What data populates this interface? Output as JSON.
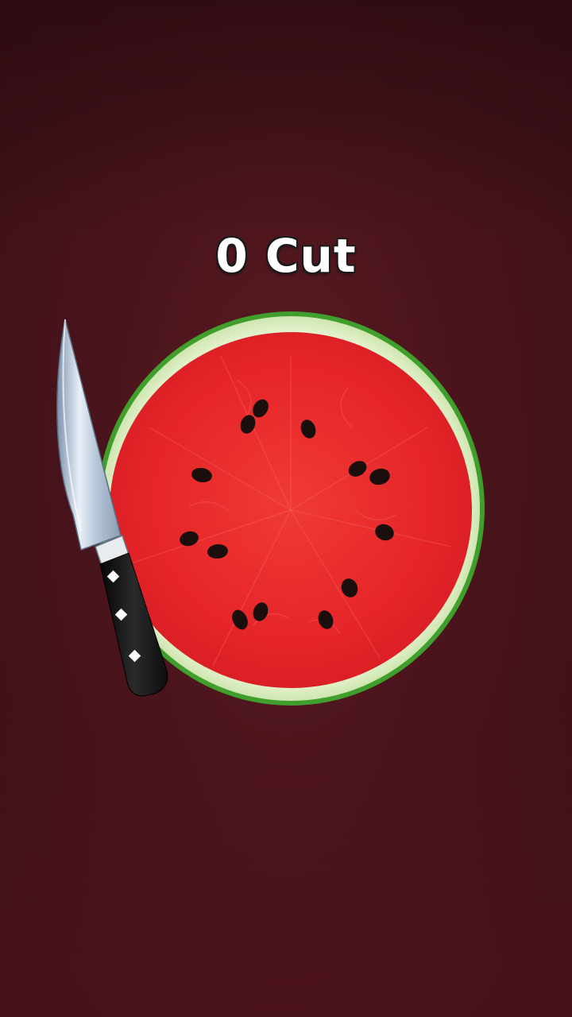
{
  "hud": {
    "cut_count": "0 Cut"
  },
  "game": {
    "fruit": "watermelon-slice",
    "tool": "knife-icon",
    "colors": {
      "background": "#4a141c",
      "flesh": "#e8262a",
      "rind_green": "#3f9e2c",
      "rind_light": "#dff0c8",
      "seed": "#1a0f0c",
      "blade": "#c8d8e8",
      "handle": "#1b1b1b"
    }
  }
}
